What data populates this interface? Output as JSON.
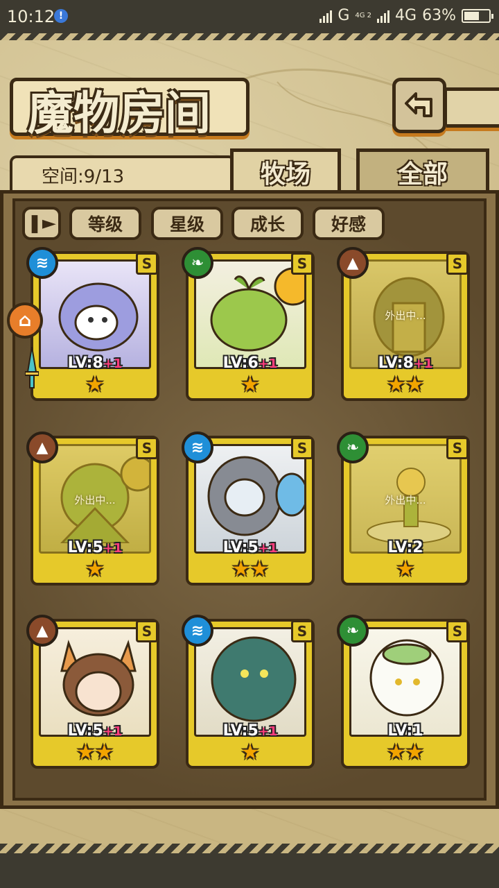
{
  "status_bar": {
    "time": "10:12",
    "notification_badge": "!",
    "signal_label_1": "G",
    "network_label_small": "4G 2",
    "network_label": "4G",
    "battery_percent": "63%",
    "battery_level": 0.63
  },
  "header": {
    "title": "魔物房间",
    "back_icon": "back-arrow-icon"
  },
  "space": {
    "label": "空间:9/13"
  },
  "tabs": [
    {
      "label": "牧场",
      "active": true
    },
    {
      "label": "全部",
      "active": false
    }
  ],
  "filters": {
    "toggle_icon": "pause-icon",
    "items": [
      {
        "label": "等级"
      },
      {
        "label": "星级"
      },
      {
        "label": "成长"
      },
      {
        "label": "好感"
      }
    ]
  },
  "monsters": [
    {
      "element": "water",
      "element_icon": "wave-icon",
      "rank": "S",
      "level": "LV:8",
      "plus": "+1",
      "stars": "★",
      "away": ""
    },
    {
      "element": "grass",
      "element_icon": "leaf-icon",
      "rank": "S",
      "level": "LV:6",
      "plus": "+1",
      "stars": "★",
      "away": ""
    },
    {
      "element": "earth",
      "element_icon": "mountain-icon",
      "rank": "S",
      "level": "LV:8",
      "plus": "+1",
      "stars": "★★",
      "away": "外出中..."
    },
    {
      "element": "earth",
      "element_icon": "mountain-icon",
      "rank": "S",
      "level": "LV:5",
      "plus": "+1",
      "stars": "★",
      "away": "外出中..."
    },
    {
      "element": "water",
      "element_icon": "wave-icon",
      "rank": "S",
      "level": "LV:5",
      "plus": "+1",
      "stars": "★★",
      "away": ""
    },
    {
      "element": "grass",
      "element_icon": "leaf-icon",
      "rank": "S",
      "level": "LV:2",
      "plus": "",
      "stars": "★",
      "away": "外出中..."
    },
    {
      "element": "earth",
      "element_icon": "mountain-icon",
      "rank": "S",
      "level": "LV:5",
      "plus": "+1",
      "stars": "★★",
      "away": ""
    },
    {
      "element": "water",
      "element_icon": "wave-icon",
      "rank": "S",
      "level": "LV:5",
      "plus": "+1",
      "stars": "★",
      "away": ""
    },
    {
      "element": "grass",
      "element_icon": "leaf-icon",
      "rank": "S",
      "level": "LV:1",
      "plus": "",
      "stars": "★★",
      "away": ""
    }
  ],
  "colors": {
    "water": "#1f8fd8",
    "grass": "#2e8f35",
    "earth": "#8a4a2a",
    "card_gold": "#e6c92a",
    "outline": "#3b2a14"
  }
}
